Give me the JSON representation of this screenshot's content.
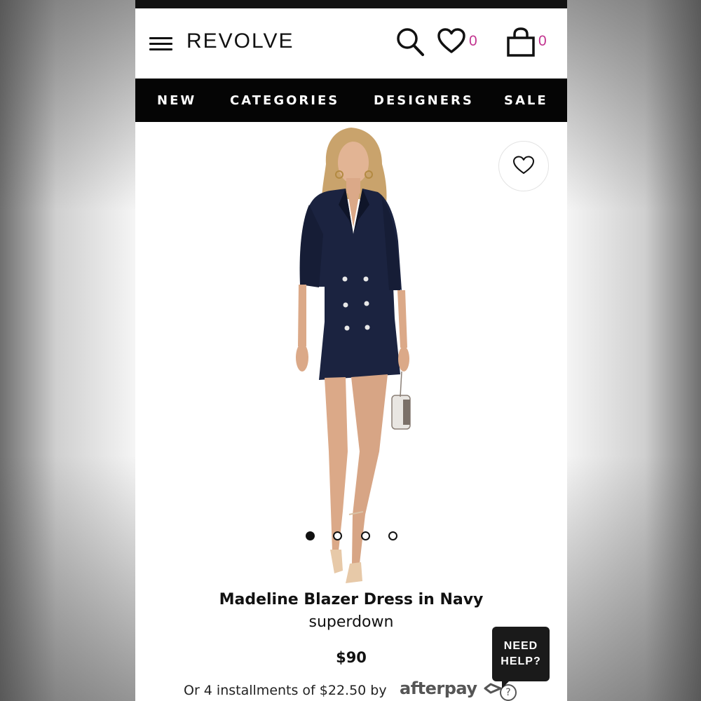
{
  "header": {
    "logo": "REVOLVE",
    "menu_icon": "hamburger-menu-icon",
    "search_icon": "search-icon",
    "wishlist_icon": "heart-icon",
    "wishlist_count": "0",
    "bag_icon": "shopping-bag-icon",
    "bag_count": "0",
    "count_color": "#c2338f"
  },
  "nav": {
    "items": [
      {
        "label": "NEW"
      },
      {
        "label": "CATEGORIES"
      },
      {
        "label": "DESIGNERS"
      },
      {
        "label": "SALE"
      }
    ]
  },
  "gallery": {
    "favorite_icon": "heart-outline-icon",
    "image": "model-wearing-navy-double-breasted-blazer-dress",
    "slide_count": 4,
    "active_slide": 1
  },
  "product": {
    "title": "Madeline Blazer Dress in Navy",
    "brand": "superdown",
    "price": "$90",
    "installments_text": "Or 4 installments of $22.50 by",
    "afterpay_logo": "afterpay",
    "afterpay_help": "?"
  },
  "help_widget": {
    "line1": "NEED",
    "line2": "HELP?"
  }
}
